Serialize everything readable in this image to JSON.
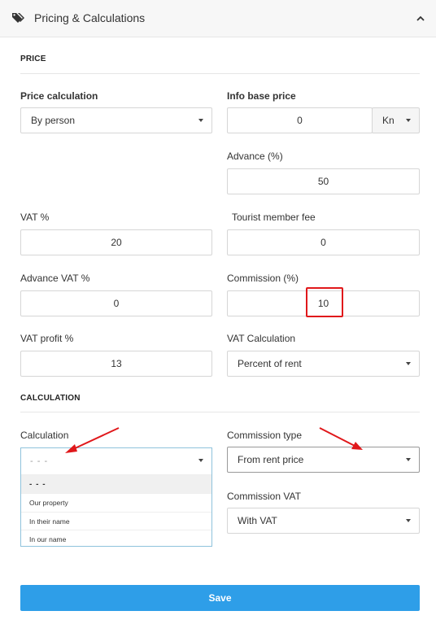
{
  "header": {
    "title": "Pricing & Calculations",
    "icon": "tag-icon",
    "collapse_icon": "chevron-up-icon"
  },
  "price_section": {
    "title": "PRICE",
    "price_calculation": {
      "label": "Price calculation",
      "value": "By person"
    },
    "info_base_price": {
      "label": "Info base price",
      "value": "0",
      "currency": "Kn"
    },
    "advance": {
      "label": "Advance (%)",
      "value": "50"
    },
    "vat": {
      "label": "VAT %",
      "value": "20"
    },
    "tourist_member_fee": {
      "label": "Tourist member fee",
      "value": "0"
    },
    "advance_vat": {
      "label": "Advance VAT %",
      "value": "0"
    },
    "commission": {
      "label": "Commission (%)",
      "value": "10"
    },
    "vat_profit": {
      "label": "VAT profit %",
      "value": "13"
    },
    "vat_calculation": {
      "label": "VAT Calculation",
      "value": "Percent of rent"
    }
  },
  "calculation_section": {
    "title": "CALCULATION",
    "calculation": {
      "label": "Calculation",
      "value": "- - -",
      "options": [
        "- - -",
        "Our property",
        "In their name",
        "In our name"
      ]
    },
    "commission_type": {
      "label": "Commission type",
      "value": "From rent price"
    },
    "commission_vat": {
      "label": "Commission VAT",
      "value": "With VAT"
    }
  },
  "save_label": "Save",
  "annotation_color": "#e0181b",
  "accent_color": "#2e9ee8"
}
